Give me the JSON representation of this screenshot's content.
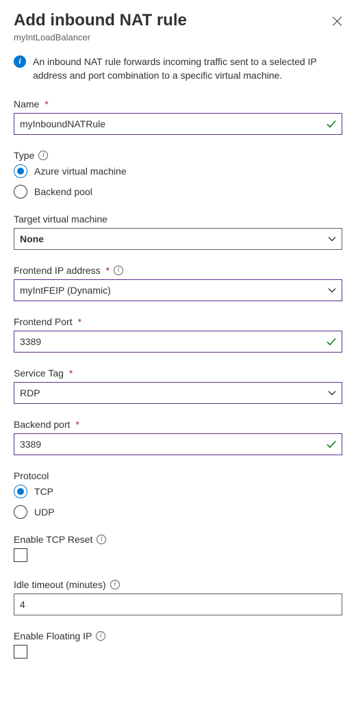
{
  "header": {
    "title": "Add inbound NAT rule",
    "subtitle": "myIntLoadBalancer"
  },
  "infobox": {
    "text": "An inbound NAT rule forwards incoming traffic sent to a selected IP address and port combination to a specific virtual machine."
  },
  "labels": {
    "name": "Name",
    "type": "Type",
    "target_vm": "Target virtual machine",
    "frontend_ip": "Frontend IP address",
    "frontend_port": "Frontend Port",
    "service_tag": "Service Tag",
    "backend_port": "Backend port",
    "protocol": "Protocol",
    "enable_tcp_reset": "Enable TCP Reset",
    "idle_timeout": "Idle timeout (minutes)",
    "enable_floating_ip": "Enable Floating IP"
  },
  "values": {
    "name": "myInboundNATRule",
    "target_vm": "None",
    "frontend_ip": "myIntFEIP (Dynamic)",
    "frontend_port": "3389",
    "service_tag": "RDP",
    "backend_port": "3389",
    "idle_timeout": "4"
  },
  "type_options": {
    "avm": "Azure virtual machine",
    "bpool": "Backend pool",
    "selected": "avm"
  },
  "protocol_options": {
    "tcp": "TCP",
    "udp": "UDP",
    "selected": "tcp"
  },
  "checkboxes": {
    "enable_tcp_reset": false,
    "enable_floating_ip": false
  }
}
